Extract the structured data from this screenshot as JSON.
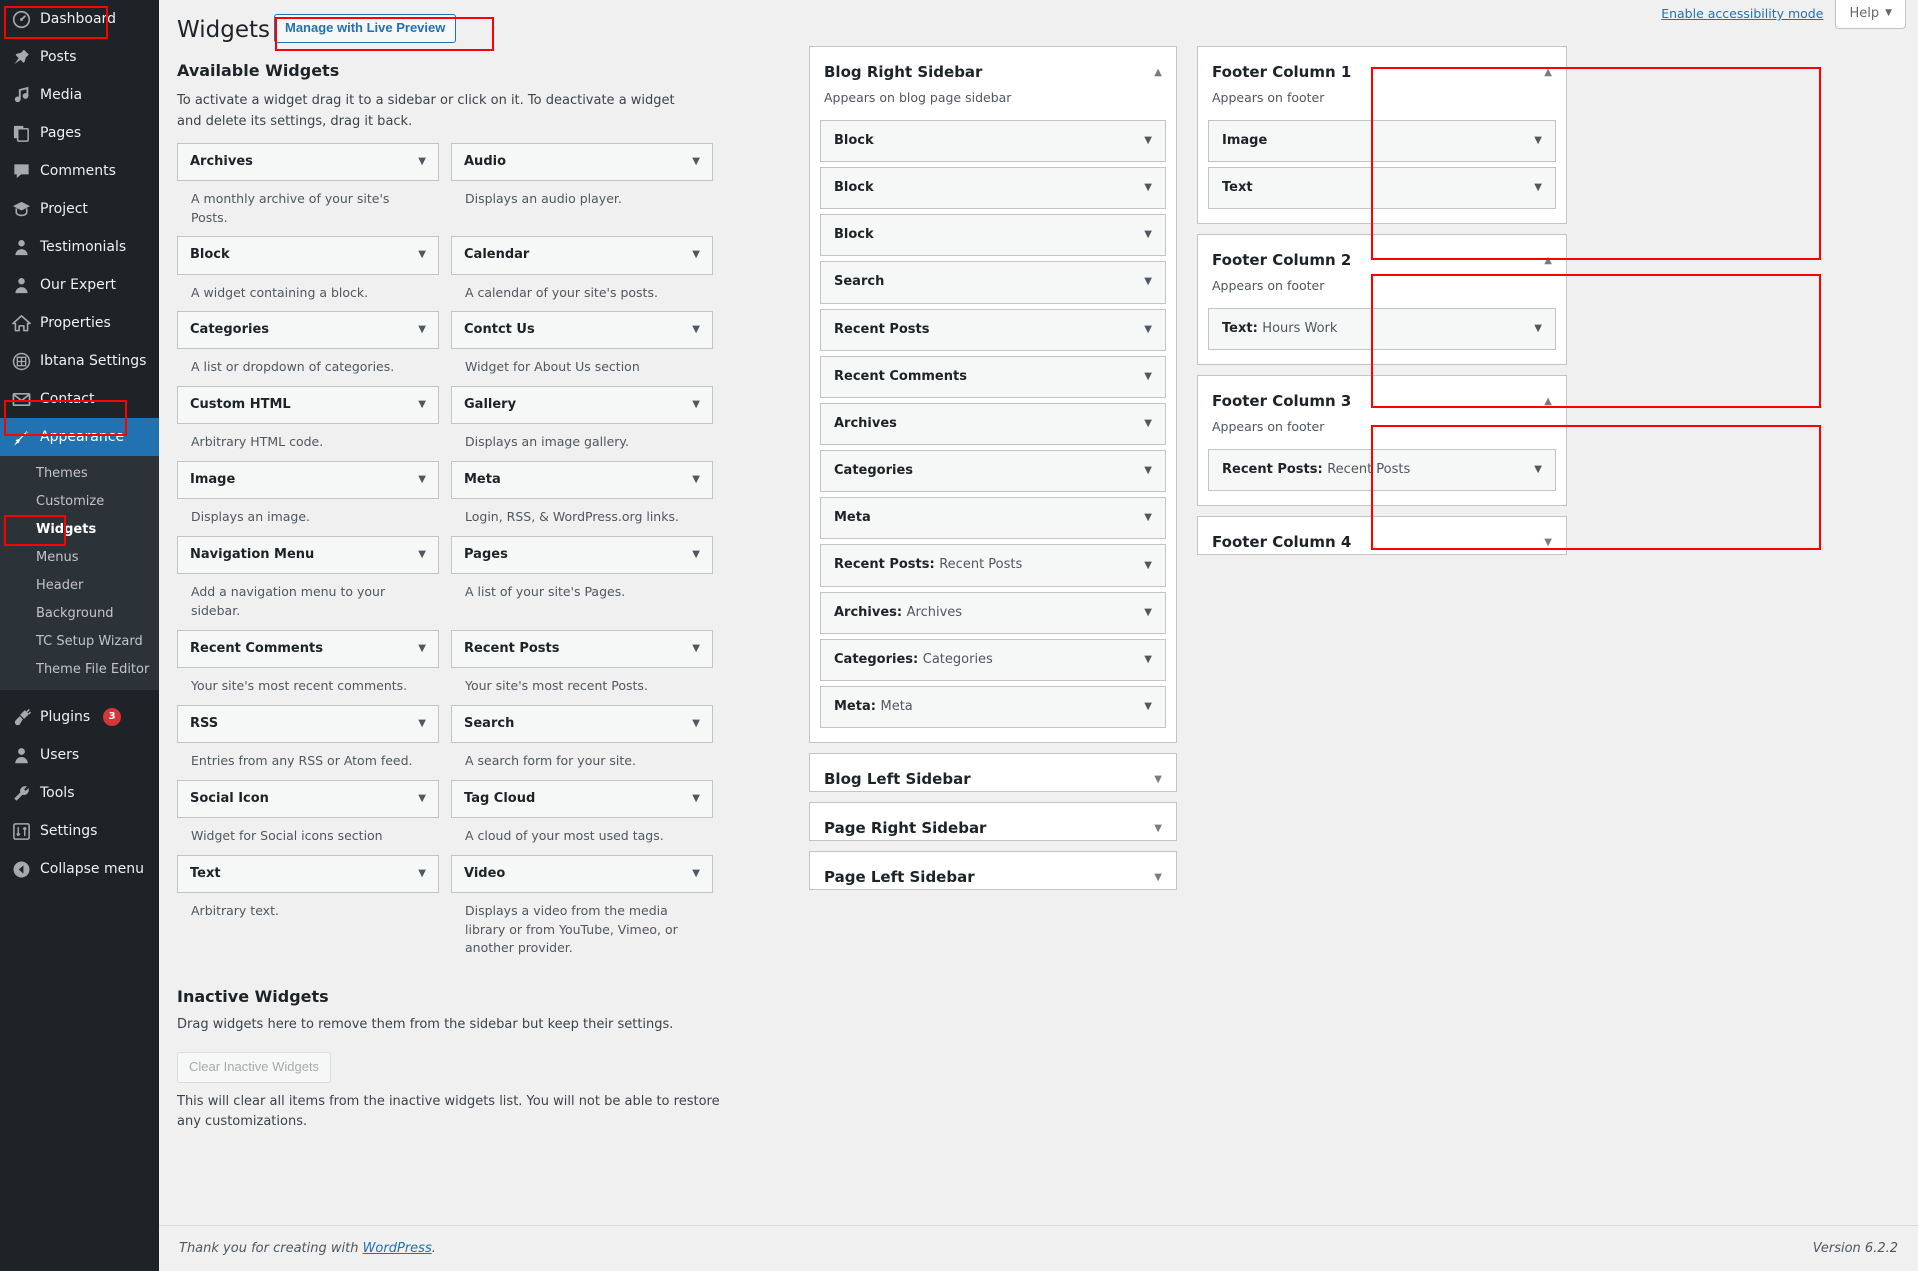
{
  "colors": {
    "accent": "#2271b1",
    "sidebar_bg": "#1d2327",
    "submenu_bg": "#2c3338",
    "highlight_box": "#ff0000",
    "badge": "#d63638",
    "page_bg": "#f0f0f1"
  },
  "admin_menu": {
    "items": [
      {
        "label": "Dashboard",
        "icon": "dashboard-icon",
        "current": false,
        "highlighted": true
      },
      {
        "label": "Posts",
        "icon": "pin-icon",
        "current": false
      },
      {
        "label": "Media",
        "icon": "media-icon",
        "current": false
      },
      {
        "label": "Pages",
        "icon": "pages-icon",
        "current": false
      },
      {
        "label": "Comments",
        "icon": "comments-icon",
        "current": false
      },
      {
        "label": "Project",
        "icon": "project-icon",
        "current": false
      },
      {
        "label": "Testimonials",
        "icon": "user-icon",
        "current": false
      },
      {
        "label": "Our Expert",
        "icon": "user-icon",
        "current": false
      },
      {
        "label": "Properties",
        "icon": "home-icon",
        "current": false
      },
      {
        "label": "Ibtana Settings",
        "icon": "grid-icon",
        "current": false
      },
      {
        "label": "Contact",
        "icon": "envelope-icon",
        "current": false
      },
      {
        "label": "Appearance",
        "icon": "paintbrush-icon",
        "current": true,
        "highlighted": true
      }
    ],
    "appearance_submenu": [
      {
        "label": "Themes",
        "current": false
      },
      {
        "label": "Customize",
        "current": false
      },
      {
        "label": "Widgets",
        "current": true,
        "highlighted": true
      },
      {
        "label": "Menus",
        "current": false
      },
      {
        "label": "Header",
        "current": false
      },
      {
        "label": "Background",
        "current": false
      },
      {
        "label": "TC Setup Wizard",
        "current": false
      },
      {
        "label": "Theme File Editor",
        "current": false
      }
    ],
    "bottom_items": [
      {
        "label": "Plugins",
        "icon": "plug-icon",
        "badge": "3"
      },
      {
        "label": "Users",
        "icon": "users-icon",
        "badge": ""
      },
      {
        "label": "Tools",
        "icon": "wrench-icon",
        "badge": ""
      },
      {
        "label": "Settings",
        "icon": "settings-icon",
        "badge": ""
      },
      {
        "label": "Collapse menu",
        "icon": "collapse-icon",
        "badge": ""
      }
    ]
  },
  "screen_meta": {
    "accessibility_link": "Enable accessibility mode",
    "help_label": "Help",
    "help_caret": "▼"
  },
  "header": {
    "title": "Widgets",
    "live_preview_label": "Manage with Live Preview"
  },
  "available": {
    "title": "Available Widgets",
    "description": "To activate a widget drag it to a sidebar or click on it. To deactivate a widget and delete its settings, drag it back.",
    "arrow": "▼",
    "widgets": [
      {
        "name": "Archives",
        "desc": "A monthly archive of your site's Posts."
      },
      {
        "name": "Audio",
        "desc": "Displays an audio player."
      },
      {
        "name": "Block",
        "desc": "A widget containing a block."
      },
      {
        "name": "Calendar",
        "desc": "A calendar of your site's posts."
      },
      {
        "name": "Categories",
        "desc": "A list or dropdown of categories."
      },
      {
        "name": "Contct Us",
        "desc": "Widget for About Us section"
      },
      {
        "name": "Custom HTML",
        "desc": "Arbitrary HTML code."
      },
      {
        "name": "Gallery",
        "desc": "Displays an image gallery."
      },
      {
        "name": "Image",
        "desc": "Displays an image."
      },
      {
        "name": "Meta",
        "desc": "Login, RSS, & WordPress.org links."
      },
      {
        "name": "Navigation Menu",
        "desc": "Add a navigation menu to your sidebar."
      },
      {
        "name": "Pages",
        "desc": "A list of your site's Pages."
      },
      {
        "name": "Recent Comments",
        "desc": "Your site's most recent comments."
      },
      {
        "name": "Recent Posts",
        "desc": "Your site's most recent Posts."
      },
      {
        "name": "RSS",
        "desc": "Entries from any RSS or Atom feed."
      },
      {
        "name": "Search",
        "desc": "A search form for your site."
      },
      {
        "name": "Social Icon",
        "desc": "Widget for Social icons section"
      },
      {
        "name": "Tag Cloud",
        "desc": "A cloud of your most used tags."
      },
      {
        "name": "Text",
        "desc": "Arbitrary text."
      },
      {
        "name": "Video",
        "desc": "Displays a video from the media library or from YouTube, Vimeo, or another provider."
      }
    ]
  },
  "inactive": {
    "title": "Inactive Widgets",
    "description": "Drag widgets here to remove them from the sidebar but keep their settings.",
    "clear_button": "Clear Inactive Widgets",
    "clear_note": "This will clear all items from the inactive widgets list. You will not be able to restore any customizations."
  },
  "sidebars": [
    {
      "title": "Blog Right Sidebar",
      "desc": "Appears on blog page sidebar",
      "open": true,
      "toggle": "▲",
      "highlighted": false,
      "widgets": [
        {
          "name": "Block",
          "instance": ""
        },
        {
          "name": "Block",
          "instance": ""
        },
        {
          "name": "Block",
          "instance": ""
        },
        {
          "name": "Search",
          "instance": ""
        },
        {
          "name": "Recent Posts",
          "instance": ""
        },
        {
          "name": "Recent Comments",
          "instance": ""
        },
        {
          "name": "Archives",
          "instance": ""
        },
        {
          "name": "Categories",
          "instance": ""
        },
        {
          "name": "Meta",
          "instance": ""
        },
        {
          "name": "Recent Posts",
          "instance": "Recent Posts"
        },
        {
          "name": "Archives",
          "instance": "Archives"
        },
        {
          "name": "Categories",
          "instance": "Categories"
        },
        {
          "name": "Meta",
          "instance": "Meta"
        }
      ]
    },
    {
      "title": "Blog Left Sidebar",
      "desc": "",
      "open": false,
      "toggle": "▼",
      "highlighted": false,
      "widgets": []
    },
    {
      "title": "Page Right Sidebar",
      "desc": "",
      "open": false,
      "toggle": "▼",
      "highlighted": false,
      "widgets": []
    },
    {
      "title": "Page Left Sidebar",
      "desc": "",
      "open": false,
      "toggle": "▼",
      "highlighted": false,
      "widgets": []
    }
  ],
  "footer_columns": [
    {
      "title": "Footer Column 1",
      "desc": "Appears on footer",
      "open": true,
      "toggle": "▲",
      "highlighted": true,
      "widgets": [
        {
          "name": "Image",
          "instance": ""
        },
        {
          "name": "Text",
          "instance": ""
        }
      ]
    },
    {
      "title": "Footer Column 2",
      "desc": "Appears on footer",
      "open": true,
      "toggle": "▲",
      "highlighted": true,
      "widgets": [
        {
          "name": "Text",
          "instance": "Hours Work"
        }
      ]
    },
    {
      "title": "Footer Column 3",
      "desc": "Appears on footer",
      "open": true,
      "toggle": "▲",
      "highlighted": true,
      "widgets": [
        {
          "name": "Recent Posts",
          "instance": "Recent Posts"
        }
      ]
    },
    {
      "title": "Footer Column 4",
      "desc": "",
      "open": false,
      "toggle": "▼",
      "highlighted": false,
      "widgets": []
    }
  ],
  "footer": {
    "thanks_prefix": "Thank you for creating with ",
    "wordpress_link": "WordPress",
    "thanks_suffix": ".",
    "version": "Version 6.2.2"
  }
}
